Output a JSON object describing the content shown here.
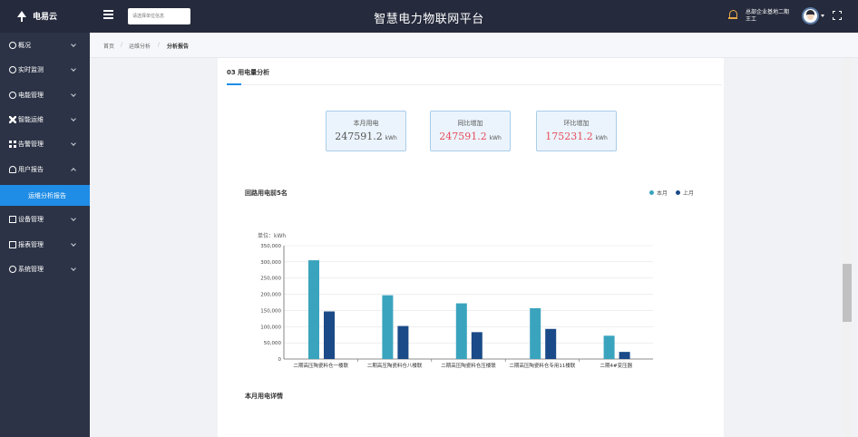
{
  "header": {
    "logo_text": "电易云",
    "search_placeholder": "请选择单位信息",
    "platform_title": "智慧电力物联网平台",
    "user_line1": "总部企业基地二期",
    "user_line2": "王工"
  },
  "sidebar": {
    "items": [
      {
        "label": "概况",
        "icon": "dashboard-icon"
      },
      {
        "label": "实时监测",
        "icon": "monitor-icon"
      },
      {
        "label": "电能管理",
        "icon": "power-icon"
      },
      {
        "label": "智能运维",
        "icon": "tools-icon"
      },
      {
        "label": "告警管理",
        "icon": "alarm-icon"
      },
      {
        "label": "用户报告",
        "icon": "user-report-icon",
        "expanded": true
      },
      {
        "label": "设备管理",
        "icon": "device-icon"
      },
      {
        "label": "报表管理",
        "icon": "report-icon"
      },
      {
        "label": "系统管理",
        "icon": "system-icon"
      }
    ],
    "sub_item": "运维分析报告"
  },
  "breadcrumb": {
    "home": "首页",
    "level1": "运维分析",
    "current": "分析报告"
  },
  "section": {
    "title": "03 用电量分析"
  },
  "stats": [
    {
      "label": "本月用电",
      "value": "247591.2",
      "unit": "kWh",
      "color": "#555555"
    },
    {
      "label": "同比增加",
      "value": "247591.2",
      "unit": "kWh",
      "color": "#e74c5a"
    },
    {
      "label": "环比增加",
      "value": "175231.2",
      "unit": "kWh",
      "color": "#e74c5a"
    }
  ],
  "chart": {
    "title": "回路用电前5名",
    "legend_current": "本月",
    "legend_last": "上月"
  },
  "chart_data": {
    "type": "bar",
    "ylabel": "单位：kWh",
    "ylim": [
      0,
      350000
    ],
    "yticks": [
      "0",
      "50,000",
      "100,000",
      "150,000",
      "200,000",
      "250,000",
      "300,000",
      "350,000"
    ],
    "categories": [
      "二期高压陶瓷料仓一楼联",
      "二期高压陶瓷料仓八楼联",
      "二期高压陶瓷料仓压楼联",
      "二期高压陶瓷料仓专用11楼联",
      "二期4#变压器"
    ],
    "series": [
      {
        "name": "本月",
        "color": "#3aa4be",
        "values": [
          305000,
          197000,
          172000,
          157000,
          72000
        ]
      },
      {
        "name": "上月",
        "color": "#1a4a87",
        "values": [
          147000,
          102000,
          83000,
          93000,
          22000
        ]
      }
    ],
    "grid": true,
    "legend_position": "top-right"
  },
  "detail": {
    "title": "本月用电详情"
  },
  "colors": {
    "header_bg": "#252a3c",
    "sidebar_bg": "#2c3346",
    "accent": "#1f8ce6"
  }
}
